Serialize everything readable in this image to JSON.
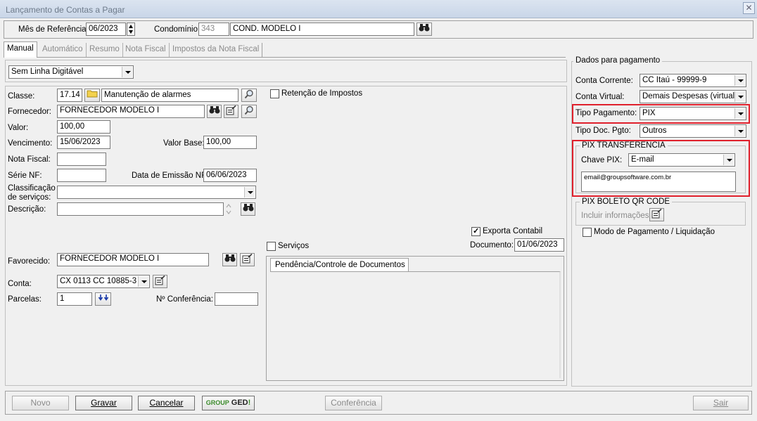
{
  "window": {
    "title": "Lançamento de Contas a Pagar",
    "close_glyph": "✕"
  },
  "header": {
    "mes_label": "Mês de Referência:",
    "mes_value": "06/2023",
    "condominio_label": "Condomínio:",
    "condominio_code": "343",
    "condominio_name": "COND. MODELO I"
  },
  "tabs": [
    {
      "label": "Manual",
      "active": true
    },
    {
      "label": "Automático",
      "active": false
    },
    {
      "label": "Resumo",
      "active": false
    },
    {
      "label": "Nota Fiscal",
      "active": false
    },
    {
      "label": "Impostos da Nota Fiscal",
      "active": false
    }
  ],
  "linha_digitavel": "Sem Linha Digitável",
  "form": {
    "classe_label": "Classe:",
    "classe_code": "17.14",
    "classe_name": "Manutenção de alarmes",
    "fornecedor_label": "Fornecedor:",
    "fornecedor_value": "FORNECEDOR MODELO I",
    "valor_label": "Valor:",
    "valor_value": "100,00",
    "vencimento_label": "Vencimento:",
    "vencimento_value": "15/06/2023",
    "valor_base_label": "Valor Base:",
    "valor_base_value": "100,00",
    "nota_fiscal_label": "Nota Fiscal:",
    "nota_fiscal_value": "",
    "serie_nf_label": "Série NF:",
    "serie_nf_value": "",
    "data_emissao_label": "Data de Emissão NF:",
    "data_emissao_value": "06/06/2023",
    "classificacao_label_1": "Classificação",
    "classificacao_label_2": "de serviços:",
    "classificacao_value": "",
    "descricao_label": "Descrição:",
    "descricao_value": "",
    "retencao_label": "Retenção de Impostos",
    "retencao_checked": false,
    "exporta_label": "Exporta Contabil",
    "exporta_checked": true,
    "servicos_label": "Serviços",
    "servicos_checked": false,
    "documento_label": "Documento:",
    "documento_value": "01/06/2023",
    "favorecido_label": "Favorecido:",
    "favorecido_value": "FORNECEDOR MODELO I",
    "conta_label": "Conta:",
    "conta_value": "CX 0113 CC 10885-3",
    "parcelas_label": "Parcelas:",
    "parcelas_value": "1",
    "conferencia_label": "Nº Conferência:",
    "conferencia_value": "",
    "pendencia_tab": "Pendência/Controle de Documentos"
  },
  "pagamento": {
    "title": "Dados para pagamento",
    "conta_corrente_label": "Conta Corrente:",
    "conta_corrente_value": "CC Itaú - 99999-9",
    "conta_virtual_label": "Conta Virtual:",
    "conta_virtual_value": "Demais Despesas (virtual)",
    "tipo_pagamento_label": "Tipo Pagamento:",
    "tipo_pagamento_value": "PIX",
    "tipo_doc_label": "Tipo Doc. Pgto:",
    "tipo_doc_value": "Outros",
    "pix_title": "PIX TRANSFERENCIA",
    "chave_pix_label": "Chave PIX:",
    "chave_pix_value": "E-mail",
    "chave_pix_text": "email@groupsoftware.com.br",
    "boleto_title": "PIX BOLETO QR CODE",
    "incluir_label": "Incluir informações:",
    "modo_label": "Modo de Pagamento / Liquidação",
    "modo_checked": false
  },
  "buttons": {
    "novo": "Novo",
    "gravar": "Gravar",
    "cancelar": "Cancelar",
    "ged_group": "GROUP",
    "ged_ged": "GED",
    "ged_bang": "!",
    "conferencia": "Conferência",
    "sair": "Sair"
  },
  "colors": {
    "highlight": "#e0202c",
    "ged_green": "#3a8a2a"
  },
  "icons": {
    "binoculars": "binoculars-icon",
    "magnifier": "magnifier-icon",
    "folder": "folder-icon",
    "edit-form": "edit-form-icon",
    "double-arrow-down": "double-arrow-down-icon"
  }
}
